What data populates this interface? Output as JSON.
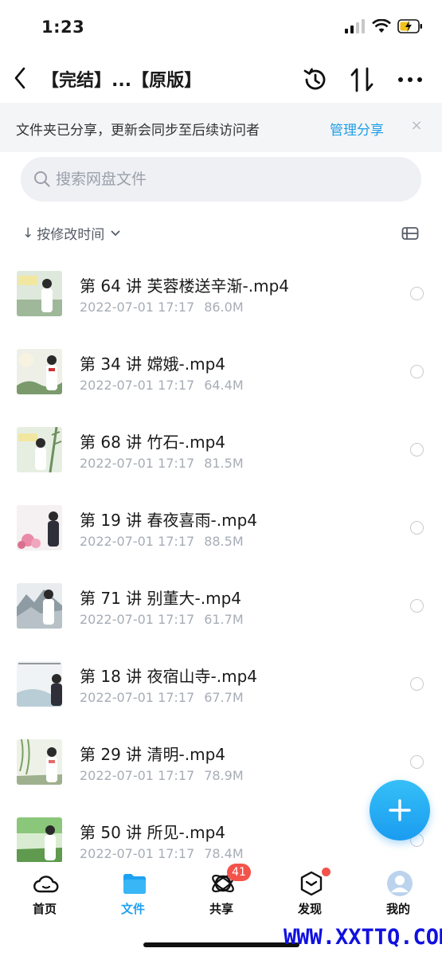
{
  "status_bar": {
    "time": "1:23"
  },
  "nav": {
    "title": "【完结】...【原版】"
  },
  "share_banner": {
    "text": "文件夹已分享，更新会同步至后续访问者",
    "manage_label": "管理分享",
    "close_glyph": "×"
  },
  "search": {
    "placeholder": "搜索网盘文件"
  },
  "sort": {
    "label": "按修改时间",
    "arrow": "↓"
  },
  "files": [
    {
      "name": "第 64 讲 芙蓉楼送辛渐-.mp4",
      "date": "2022-07-01 17:17",
      "size": "86.0M"
    },
    {
      "name": "第 34 讲 嫦娥-.mp4",
      "date": "2022-07-01 17:17",
      "size": "64.4M"
    },
    {
      "name": "第 68 讲 竹石-.mp4",
      "date": "2022-07-01 17:17",
      "size": "81.5M"
    },
    {
      "name": "第 19 讲 春夜喜雨-.mp4",
      "date": "2022-07-01 17:17",
      "size": "88.5M"
    },
    {
      "name": "第 71 讲 别董大-.mp4",
      "date": "2022-07-01 17:17",
      "size": "61.7M"
    },
    {
      "name": "第 18 讲 夜宿山寺-.mp4",
      "date": "2022-07-01 17:17",
      "size": "67.7M"
    },
    {
      "name": "第 29 讲 清明-.mp4",
      "date": "2022-07-01 17:17",
      "size": "78.9M"
    },
    {
      "name": "第 50 讲 所见-.mp4",
      "date": "2022-07-01 17:17",
      "size": "78.4M"
    }
  ],
  "tabs": [
    {
      "label": "首页",
      "icon": "cloud-icon"
    },
    {
      "label": "文件",
      "icon": "folder-icon"
    },
    {
      "label": "共享",
      "icon": "share-planet-icon",
      "badge": "41"
    },
    {
      "label": "发现",
      "icon": "discover-box-icon"
    },
    {
      "label": "我的",
      "icon": "avatar-icon"
    }
  ],
  "watermark": "WWW.XXTTQ.COM",
  "colors": {
    "accent": "#1da1f2",
    "badge": "#f3534b",
    "banner_bg": "#f4f5f7",
    "meta_text": "#a7adb6"
  }
}
